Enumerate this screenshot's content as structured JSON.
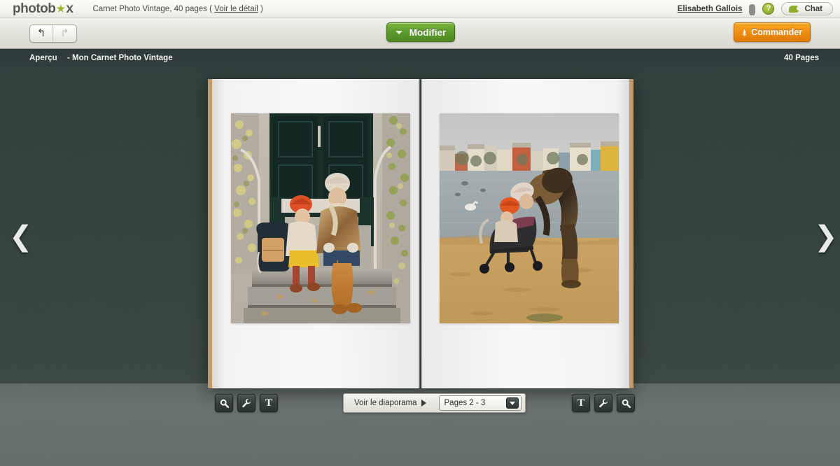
{
  "header": {
    "logo_text_a": "photob",
    "logo_text_b": "x",
    "logo_star": "star-icon",
    "doc_title": "Carnet Photo Vintage, 40 pages",
    "doc_detail_open": "(",
    "doc_detail_link": "Voir le détail",
    "doc_detail_close": ")",
    "user_name": "Elisabeth Gallois",
    "user_icon": "user-icon",
    "help_label": "?",
    "chat_label": "Chat",
    "chat_icon": "chat-bubble-icon"
  },
  "toolbar": {
    "undo_label": "↰",
    "undo_icon": "undo-arrow-icon",
    "redo_label": "↱",
    "redo_icon": "redo-arrow-icon",
    "modifier_label": "Modifier",
    "modifier_caret": "chevron-down-icon",
    "commander_label": "Commander",
    "commander_icon": "shopping-cart-icon",
    "accent_green": "#5d9a2c",
    "accent_orange": "#ef8d13"
  },
  "viewer": {
    "sub_title_mode": "Aperçu",
    "sub_title_name": "- Mon Carnet Photo Vintage",
    "page_count": "40 Pages",
    "nav_prev": "❮",
    "nav_next": "❯",
    "background_wall": "#35433f",
    "background_floor": "#6a7271",
    "spine_color": "#c19a6b"
  },
  "book": {
    "left_page": {
      "photo_name": "photo-woman-and-child-on-steps",
      "photo_alt": "Femme et enfant assis sur des marches devant une porte verte foncée"
    },
    "right_page": {
      "photo_name": "photo-woman-with-stroller-by-lake",
      "photo_alt": "Femme penchée sur une poussette au bord d'un lac avec bâtiments colorés"
    }
  },
  "bottom_controls": {
    "left_tools": [
      {
        "name": "zoom-icon",
        "glyph": "🔍"
      },
      {
        "name": "wrench-icon",
        "glyph": "🔧"
      },
      {
        "name": "text-icon",
        "glyph": "T"
      }
    ],
    "right_tools": [
      {
        "name": "text-icon",
        "glyph": "T"
      },
      {
        "name": "wrench-icon",
        "glyph": "🔧"
      },
      {
        "name": "zoom-icon",
        "glyph": "🔍"
      }
    ],
    "slideshow_label": "Voir le diaporama",
    "slideshow_icon": "play-triangle-icon",
    "page_selector_value": "Pages 2 - 3",
    "page_selector_caret": "chevron-down-icon"
  }
}
